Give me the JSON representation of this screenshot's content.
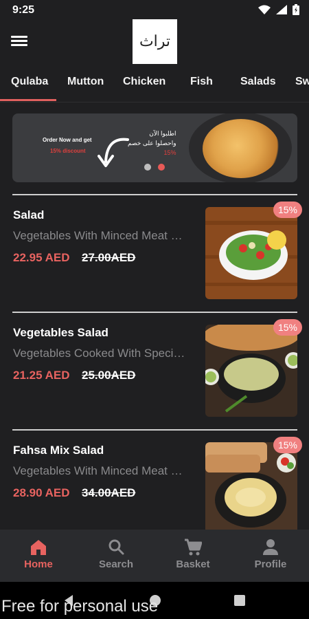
{
  "status": {
    "time": "9:25"
  },
  "header": {
    "logo_text": "تراث"
  },
  "tabs": [
    {
      "label": "Qulaba"
    },
    {
      "label": "Mutton"
    },
    {
      "label": "Chicken"
    },
    {
      "label": "Fish"
    },
    {
      "label": "Salads"
    },
    {
      "label": "Sw"
    }
  ],
  "banner": {
    "promo_line1": "Order Now and get",
    "promo_line2": "15% discount",
    "arabic_line1": "اطلبوا الآن",
    "arabic_line2": "واحصلوا على خصم",
    "arabic_line3": "15%"
  },
  "items": [
    {
      "name": "Salad",
      "description": "Vegetables With Minced Meat …",
      "price": "22.95 AED",
      "old_price": "27.00AED",
      "badge": "15%"
    },
    {
      "name": "Vegetables Salad",
      "description": "Vegetables Cooked With Speci…",
      "price": "21.25 AED",
      "old_price": "25.00AED",
      "badge": "15%"
    },
    {
      "name": "Fahsa Mix Salad",
      "description": "Vegetables With Minced Meat …",
      "price": "28.90 AED",
      "old_price": "34.00AED",
      "badge": "15%"
    }
  ],
  "bottom_nav": [
    {
      "label": "Home",
      "icon": "home-icon"
    },
    {
      "label": "Search",
      "icon": "search-icon"
    },
    {
      "label": "Basket",
      "icon": "cart-icon"
    },
    {
      "label": "Profile",
      "icon": "person-icon"
    }
  ],
  "watermark": "Free for personal use",
  "colors": {
    "background": "#1f1f21",
    "accent": "#e86360",
    "badge": "#f08080",
    "navbar": "#2a2b2e"
  }
}
